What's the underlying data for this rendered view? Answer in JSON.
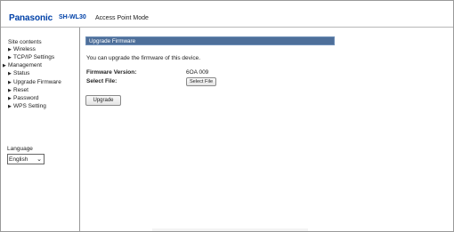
{
  "header": {
    "brand": "Panasonic",
    "model": "SH-WL30",
    "mode": "Access Point Mode"
  },
  "sidebar": {
    "title": "Site contents",
    "items": [
      {
        "label": "Wireless"
      },
      {
        "label": "TCP/IP Settings"
      },
      {
        "label": "Management"
      },
      {
        "label": "Status"
      },
      {
        "label": "Upgrade Firmware"
      },
      {
        "label": "Reset"
      },
      {
        "label": "Password"
      },
      {
        "label": "WPS Setting"
      }
    ],
    "language_label": "Language",
    "language_value": "English"
  },
  "main": {
    "title": "Upgrade Firmware",
    "description": "You can upgrade the firmware of this device.",
    "firmware_version_label": "Firmware Version:",
    "firmware_version_value": "6OA 009",
    "select_file_label": "Select File:",
    "select_file_button": "Select File",
    "upgrade_button": "Upgrade"
  },
  "colors": {
    "brand": "#0041a8",
    "title_bar": "#4e6f9a"
  }
}
